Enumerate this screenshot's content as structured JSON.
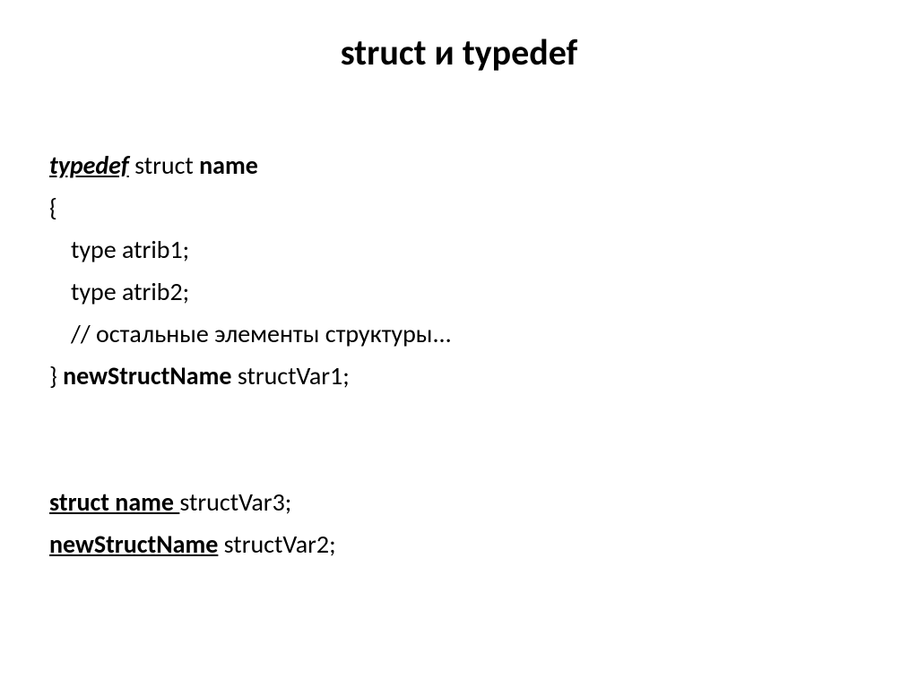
{
  "title": "struct и typedef",
  "code": {
    "l1_typedef": "typedef",
    "l1_struct": " struct ",
    "l1_name": "name",
    "l2": "{",
    "l3": "type atrib1;",
    "l4": "type atrib2;",
    "l5": "// остальные элементы структуры...",
    "l6_close": "} ",
    "l6_new": "newStructName",
    "l6_rest": " structVar1;",
    "l7_a": "struct name ",
    "l7_b": "structVar3;",
    "l8_a": "newStructName",
    "l8_b": " structVar2;"
  }
}
